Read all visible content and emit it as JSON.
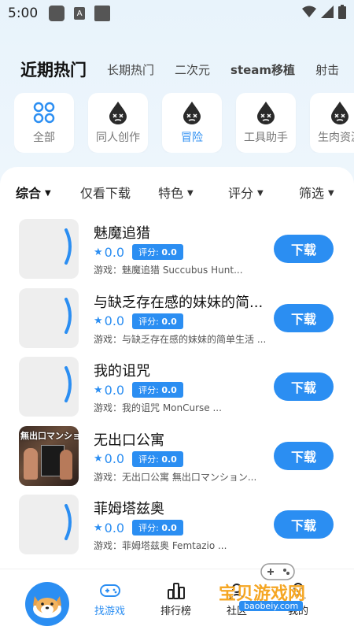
{
  "status": {
    "time": "5:00"
  },
  "top_tabs": [
    {
      "label": "近期热门"
    },
    {
      "label": "长期热门"
    },
    {
      "label": "二次元"
    },
    {
      "label": "steam移植"
    },
    {
      "label": "射击"
    }
  ],
  "categories": [
    {
      "label": "全部",
      "icon": "grid-icon"
    },
    {
      "label": "同人创作",
      "icon": "dizzy-drop-icon"
    },
    {
      "label": "冒险",
      "icon": "dizzy-drop-icon"
    },
    {
      "label": "工具助手",
      "icon": "dizzy-drop-icon"
    },
    {
      "label": "生肉资源",
      "icon": "dizzy-drop-icon"
    }
  ],
  "filters": {
    "comprehensive": "综合",
    "download_only": "仅看下载",
    "feature": "特色",
    "rating": "评分",
    "screen": "筛选"
  },
  "games": [
    {
      "title": "魅魔追猎",
      "rating": "0.0",
      "score_label": "评分:",
      "score": "0.0",
      "desc": "游戏：魅魔追猎  Succubus Hunt...",
      "download": "下载"
    },
    {
      "title": "与缺乏存在感的妹妹的简...",
      "rating": "0.0",
      "score_label": "评分:",
      "score": "0.0",
      "desc": "游戏：与缺乏存在感的妹妹的简单生活 ...",
      "download": "下载"
    },
    {
      "title": "我的诅咒",
      "rating": "0.0",
      "score_label": "评分:",
      "score": "0.0",
      "desc": "游戏：我的诅咒  MonCurse ...",
      "download": "下载"
    },
    {
      "title": "无出口公寓",
      "rating": "0.0",
      "score_label": "评分:",
      "score": "0.0",
      "desc": "游戏：无出口公寓  無出口マンション...",
      "download": "下载",
      "art_title": "無出口マンション"
    },
    {
      "title": "菲姆塔兹奥",
      "rating": "0.0",
      "score_label": "评分:",
      "score": "0.0",
      "desc": "游戏：菲姆塔兹奥  Femtazio ...",
      "download": "下载"
    }
  ],
  "bottom_nav": {
    "find_games": "找游戏",
    "rankings": "排行榜",
    "community": "社区",
    "mine": "我的"
  },
  "watermark": {
    "text": "宝贝游戏网",
    "url": "baobeiy.com"
  },
  "colors": {
    "accent": "#2b8ef2",
    "watermark": "#f5a623"
  }
}
